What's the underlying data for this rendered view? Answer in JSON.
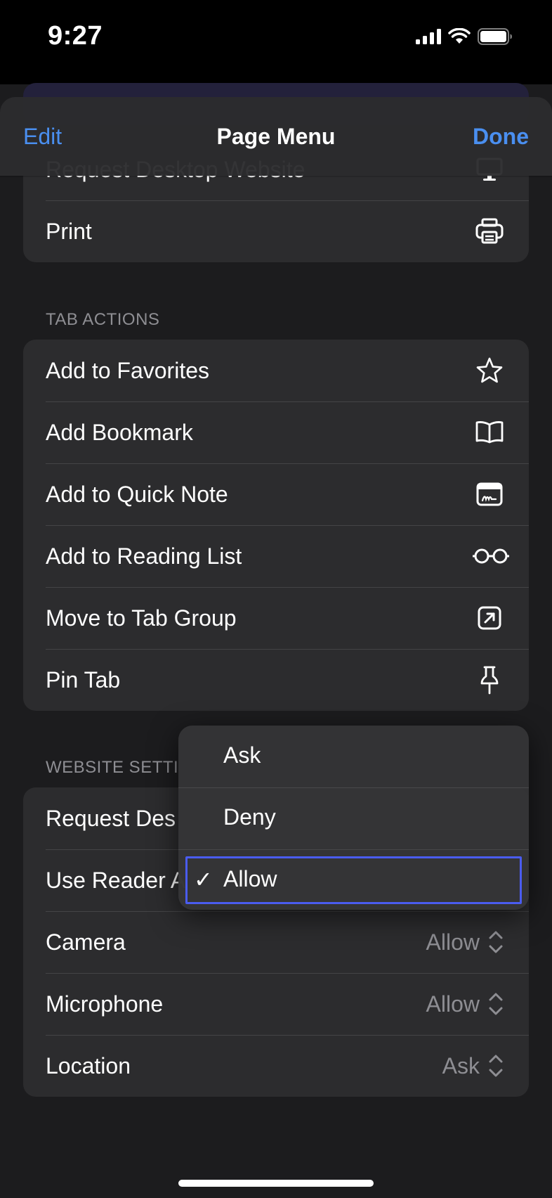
{
  "status": {
    "time": "9:27"
  },
  "nav": {
    "edit": "Edit",
    "title": "Page Menu",
    "done": "Done"
  },
  "top_group": [
    {
      "label": "Request Desktop Website",
      "icon": "desktop-icon"
    },
    {
      "label": "Print",
      "icon": "printer-icon"
    }
  ],
  "tab_actions": {
    "header": "TAB ACTIONS",
    "items": [
      {
        "label": "Add to Favorites",
        "icon": "star-icon"
      },
      {
        "label": "Add Bookmark",
        "icon": "book-icon"
      },
      {
        "label": "Add to Quick Note",
        "icon": "quick-note-icon"
      },
      {
        "label": "Add to Reading List",
        "icon": "glasses-icon"
      },
      {
        "label": "Move to Tab Group",
        "icon": "move-to-tab-group-icon"
      },
      {
        "label": "Pin Tab",
        "icon": "pin-icon"
      }
    ]
  },
  "website_settings": {
    "header": "WEBSITE SETTI",
    "items": [
      {
        "label": "Request Des"
      },
      {
        "label": "Use Reader A"
      },
      {
        "label": "Camera",
        "value": "Allow"
      },
      {
        "label": "Microphone",
        "value": "Allow"
      },
      {
        "label": "Location",
        "value": "Ask"
      }
    ]
  },
  "popup": {
    "options": [
      "Ask",
      "Deny",
      "Allow"
    ],
    "selected": "Allow",
    "check_glyph": "✓"
  },
  "colors": {
    "accent": "#4a8ff0",
    "focus": "#4a5cf0"
  }
}
